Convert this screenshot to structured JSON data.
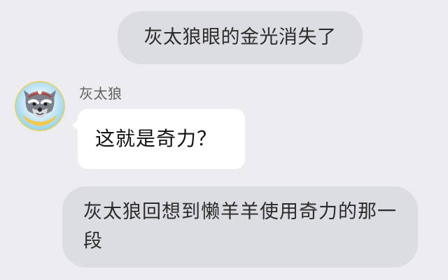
{
  "messages": {
    "system_top": "灰太狼眼的金光消失了",
    "sender_name": "灰太狼",
    "chat_text": "这就是奇力？",
    "system_bottom": "灰太狼回想到懒羊羊使用奇力的那一段"
  },
  "colors": {
    "background": "#ededf1",
    "system_bubble": "#dcdde2",
    "chat_bubble": "#ffffff",
    "avatar_ring": "#8fd2ee"
  },
  "icons": {
    "avatar": "gray-wolf-avatar"
  }
}
